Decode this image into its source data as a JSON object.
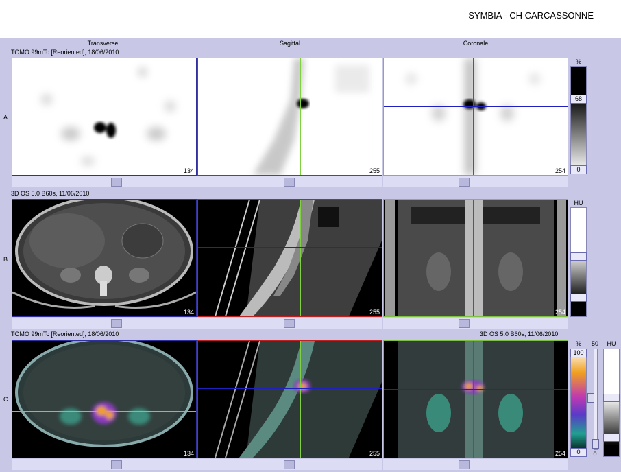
{
  "header": {
    "title": "SYMBIA - CH CARCASSONNE"
  },
  "views": {
    "transverse": "Transverse",
    "sagittal": "Sagittal",
    "coronal": "Coronale"
  },
  "rows": {
    "a": {
      "label": "A",
      "series": "TOMO 99mTc [Reoriented], 18/06/2010"
    },
    "b": {
      "label": "B",
      "series": "3D  OS  5.0  B60s, 11/06/2010"
    },
    "c": {
      "label": "C",
      "series_left": "TOMO 99mTc [Reoriented], 18/06/2010",
      "series_right": "3D  OS  5.0  B60s, 11/06/2010"
    }
  },
  "slices": {
    "transverse": "134",
    "sagittal": "255",
    "coronal": "254"
  },
  "scales": {
    "a": {
      "unit": "%",
      "max": "68",
      "min": "0"
    },
    "b": {
      "unit": "HU"
    },
    "c": {
      "unit": "%",
      "max": "100",
      "min": "0",
      "blend": "50",
      "blend_zero": "0",
      "unit_ct": "HU"
    }
  },
  "colors": {
    "transverse_border": "#3030a0",
    "sagittal_border": "#c02020",
    "coronal_border": "#80c040",
    "crosshair_red": "#e02020",
    "crosshair_green": "#80d040",
    "crosshair_blue": "#2020c0"
  }
}
